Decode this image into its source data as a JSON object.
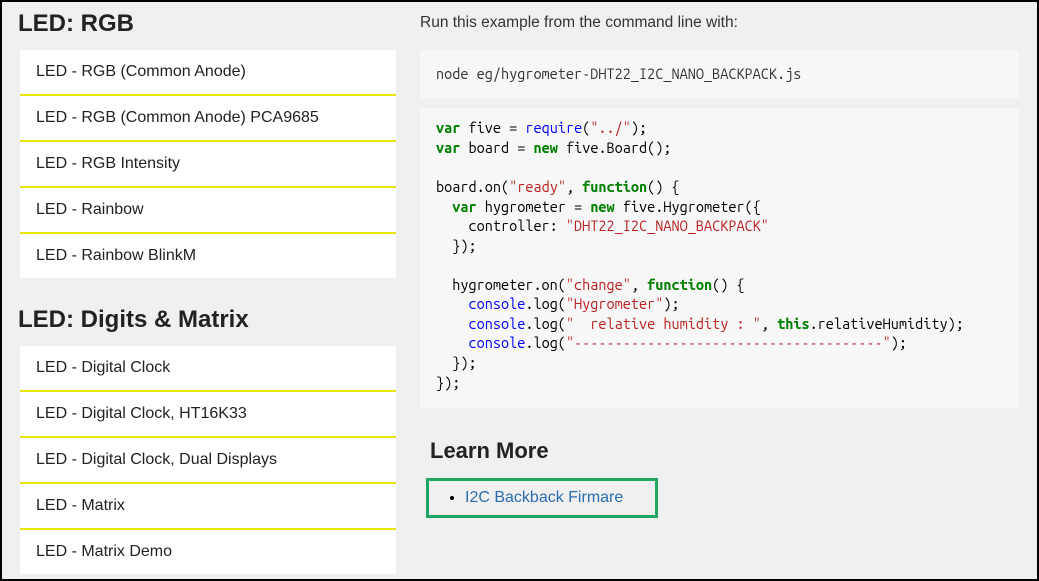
{
  "sidebar": {
    "section1_title": "LED: RGB",
    "section1_items": [
      "LED - RGB (Common Anode)",
      "LED - RGB (Common Anode) PCA9685",
      "LED - RGB Intensity",
      "LED - Rainbow",
      "LED - Rainbow BlinkM"
    ],
    "section2_title": "LED: Digits & Matrix",
    "section2_items": [
      "LED - Digital Clock",
      "LED - Digital Clock, HT16K33",
      "LED - Digital Clock, Dual Displays",
      "LED - Matrix",
      "LED - Matrix Demo"
    ]
  },
  "content": {
    "intro": "Run this example from the command line with:",
    "cmd": "node eg/hygrometer-DHT22_I2C_NANO_BACKPACK.js",
    "code": {
      "l1a": "var",
      "l1b": " five = ",
      "l1c": "require",
      "l1d": "(",
      "l1e": "\"../\"",
      "l1f": ");",
      "l2a": "var",
      "l2b": " board = ",
      "l2c": "new",
      "l2d": " five.Board();",
      "l3a": "board.on(",
      "l3b": "\"ready\"",
      "l3c": ", ",
      "l3d": "function",
      "l3e": "() {",
      "l4a": "  ",
      "l4b": "var",
      "l4c": " hygrometer = ",
      "l4d": "new",
      "l4e": " five.Hygrometer({",
      "l5a": "    controller: ",
      "l5b": "\"DHT22_I2C_NANO_BACKPACK\"",
      "l6": "  });",
      "l7": "",
      "l8a": "  hygrometer.on(",
      "l8b": "\"change\"",
      "l8c": ", ",
      "l8d": "function",
      "l8e": "() {",
      "l9a": "    ",
      "l9b": "console",
      "l9c": ".log(",
      "l9d": "\"Hygrometer\"",
      "l9e": ");",
      "l10a": "    ",
      "l10b": "console",
      "l10c": ".log(",
      "l10d": "\"  relative humidity : \"",
      "l10e": ", ",
      "l10f": "this",
      "l10g": ".relativeHumidity);",
      "l11a": "    ",
      "l11b": "console",
      "l11c": ".log(",
      "l11d": "\"--------------------------------------\"",
      "l11e": ");",
      "l12": "  });",
      "l13": "});"
    },
    "learn_more_heading": "Learn More",
    "learn_more_link": "I2C Backback Firmare"
  }
}
